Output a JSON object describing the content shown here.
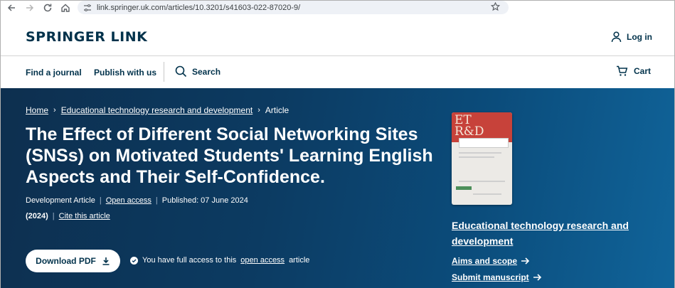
{
  "browser": {
    "url": "link.springer.uk.com/articles/10.3201/s41603-022-87020-9/"
  },
  "header": {
    "logo": "SPRINGER LINK",
    "login_label": "Log in"
  },
  "nav": {
    "find_journal": "Find a journal",
    "publish": "Publish with us",
    "search": "Search",
    "cart": "Cart"
  },
  "breadcrumb": {
    "home": "Home",
    "journal": "Educational technology research and development",
    "current": "Article"
  },
  "article": {
    "title": "The Effect of Different Social Networking Sites (SNSs) on Motivated Students' Learning English Aspects and Their Self-Confidence.",
    "type": "Development Article",
    "access": "Open access",
    "published": "Published: 07 June 2024",
    "year": "(2024)",
    "cite": "Cite this article"
  },
  "actions": {
    "download_label": "Download PDF",
    "access_prefix": "You have full access to this",
    "access_link": "open access",
    "access_suffix": "article"
  },
  "sidebar": {
    "cover_et": "ET",
    "cover_rd": "R&D",
    "journal_title": "Educational technology research and development",
    "aims_scope": "Aims and scope",
    "submit": "Submit manuscript"
  },
  "colors": {
    "brand": "#01324b",
    "hero_start": "#0d2f4f",
    "hero_end": "#10649a"
  }
}
